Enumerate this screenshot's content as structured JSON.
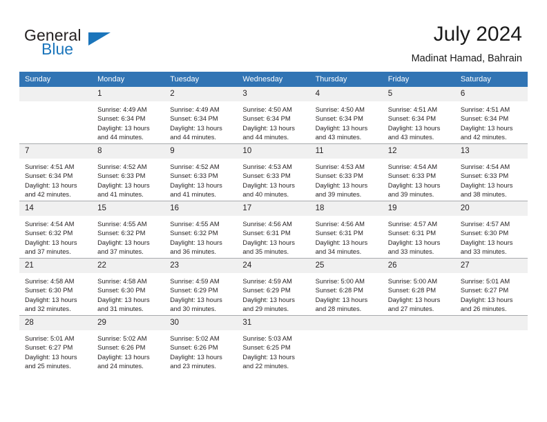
{
  "brand": {
    "line1": "General",
    "line2": "Blue",
    "accent_color": "#1b75bb"
  },
  "header": {
    "month_title": "July 2024",
    "location": "Madinat Hamad, Bahrain",
    "header_bg": "#3174b4",
    "daynum_bg": "#f0f0f0"
  },
  "weekday_headers": [
    "Sunday",
    "Monday",
    "Tuesday",
    "Wednesday",
    "Thursday",
    "Friday",
    "Saturday"
  ],
  "weeks": [
    [
      {
        "day": "",
        "sunrise": "",
        "sunset": "",
        "daylight1": "",
        "daylight2": ""
      },
      {
        "day": "1",
        "sunrise": "Sunrise: 4:49 AM",
        "sunset": "Sunset: 6:34 PM",
        "daylight1": "Daylight: 13 hours",
        "daylight2": "and 44 minutes."
      },
      {
        "day": "2",
        "sunrise": "Sunrise: 4:49 AM",
        "sunset": "Sunset: 6:34 PM",
        "daylight1": "Daylight: 13 hours",
        "daylight2": "and 44 minutes."
      },
      {
        "day": "3",
        "sunrise": "Sunrise: 4:50 AM",
        "sunset": "Sunset: 6:34 PM",
        "daylight1": "Daylight: 13 hours",
        "daylight2": "and 44 minutes."
      },
      {
        "day": "4",
        "sunrise": "Sunrise: 4:50 AM",
        "sunset": "Sunset: 6:34 PM",
        "daylight1": "Daylight: 13 hours",
        "daylight2": "and 43 minutes."
      },
      {
        "day": "5",
        "sunrise": "Sunrise: 4:51 AM",
        "sunset": "Sunset: 6:34 PM",
        "daylight1": "Daylight: 13 hours",
        "daylight2": "and 43 minutes."
      },
      {
        "day": "6",
        "sunrise": "Sunrise: 4:51 AM",
        "sunset": "Sunset: 6:34 PM",
        "daylight1": "Daylight: 13 hours",
        "daylight2": "and 42 minutes."
      }
    ],
    [
      {
        "day": "7",
        "sunrise": "Sunrise: 4:51 AM",
        "sunset": "Sunset: 6:34 PM",
        "daylight1": "Daylight: 13 hours",
        "daylight2": "and 42 minutes."
      },
      {
        "day": "8",
        "sunrise": "Sunrise: 4:52 AM",
        "sunset": "Sunset: 6:33 PM",
        "daylight1": "Daylight: 13 hours",
        "daylight2": "and 41 minutes."
      },
      {
        "day": "9",
        "sunrise": "Sunrise: 4:52 AM",
        "sunset": "Sunset: 6:33 PM",
        "daylight1": "Daylight: 13 hours",
        "daylight2": "and 41 minutes."
      },
      {
        "day": "10",
        "sunrise": "Sunrise: 4:53 AM",
        "sunset": "Sunset: 6:33 PM",
        "daylight1": "Daylight: 13 hours",
        "daylight2": "and 40 minutes."
      },
      {
        "day": "11",
        "sunrise": "Sunrise: 4:53 AM",
        "sunset": "Sunset: 6:33 PM",
        "daylight1": "Daylight: 13 hours",
        "daylight2": "and 39 minutes."
      },
      {
        "day": "12",
        "sunrise": "Sunrise: 4:54 AM",
        "sunset": "Sunset: 6:33 PM",
        "daylight1": "Daylight: 13 hours",
        "daylight2": "and 39 minutes."
      },
      {
        "day": "13",
        "sunrise": "Sunrise: 4:54 AM",
        "sunset": "Sunset: 6:33 PM",
        "daylight1": "Daylight: 13 hours",
        "daylight2": "and 38 minutes."
      }
    ],
    [
      {
        "day": "14",
        "sunrise": "Sunrise: 4:54 AM",
        "sunset": "Sunset: 6:32 PM",
        "daylight1": "Daylight: 13 hours",
        "daylight2": "and 37 minutes."
      },
      {
        "day": "15",
        "sunrise": "Sunrise: 4:55 AM",
        "sunset": "Sunset: 6:32 PM",
        "daylight1": "Daylight: 13 hours",
        "daylight2": "and 37 minutes."
      },
      {
        "day": "16",
        "sunrise": "Sunrise: 4:55 AM",
        "sunset": "Sunset: 6:32 PM",
        "daylight1": "Daylight: 13 hours",
        "daylight2": "and 36 minutes."
      },
      {
        "day": "17",
        "sunrise": "Sunrise: 4:56 AM",
        "sunset": "Sunset: 6:31 PM",
        "daylight1": "Daylight: 13 hours",
        "daylight2": "and 35 minutes."
      },
      {
        "day": "18",
        "sunrise": "Sunrise: 4:56 AM",
        "sunset": "Sunset: 6:31 PM",
        "daylight1": "Daylight: 13 hours",
        "daylight2": "and 34 minutes."
      },
      {
        "day": "19",
        "sunrise": "Sunrise: 4:57 AM",
        "sunset": "Sunset: 6:31 PM",
        "daylight1": "Daylight: 13 hours",
        "daylight2": "and 33 minutes."
      },
      {
        "day": "20",
        "sunrise": "Sunrise: 4:57 AM",
        "sunset": "Sunset: 6:30 PM",
        "daylight1": "Daylight: 13 hours",
        "daylight2": "and 33 minutes."
      }
    ],
    [
      {
        "day": "21",
        "sunrise": "Sunrise: 4:58 AM",
        "sunset": "Sunset: 6:30 PM",
        "daylight1": "Daylight: 13 hours",
        "daylight2": "and 32 minutes."
      },
      {
        "day": "22",
        "sunrise": "Sunrise: 4:58 AM",
        "sunset": "Sunset: 6:30 PM",
        "daylight1": "Daylight: 13 hours",
        "daylight2": "and 31 minutes."
      },
      {
        "day": "23",
        "sunrise": "Sunrise: 4:59 AM",
        "sunset": "Sunset: 6:29 PM",
        "daylight1": "Daylight: 13 hours",
        "daylight2": "and 30 minutes."
      },
      {
        "day": "24",
        "sunrise": "Sunrise: 4:59 AM",
        "sunset": "Sunset: 6:29 PM",
        "daylight1": "Daylight: 13 hours",
        "daylight2": "and 29 minutes."
      },
      {
        "day": "25",
        "sunrise": "Sunrise: 5:00 AM",
        "sunset": "Sunset: 6:28 PM",
        "daylight1": "Daylight: 13 hours",
        "daylight2": "and 28 minutes."
      },
      {
        "day": "26",
        "sunrise": "Sunrise: 5:00 AM",
        "sunset": "Sunset: 6:28 PM",
        "daylight1": "Daylight: 13 hours",
        "daylight2": "and 27 minutes."
      },
      {
        "day": "27",
        "sunrise": "Sunrise: 5:01 AM",
        "sunset": "Sunset: 6:27 PM",
        "daylight1": "Daylight: 13 hours",
        "daylight2": "and 26 minutes."
      }
    ],
    [
      {
        "day": "28",
        "sunrise": "Sunrise: 5:01 AM",
        "sunset": "Sunset: 6:27 PM",
        "daylight1": "Daylight: 13 hours",
        "daylight2": "and 25 minutes."
      },
      {
        "day": "29",
        "sunrise": "Sunrise: 5:02 AM",
        "sunset": "Sunset: 6:26 PM",
        "daylight1": "Daylight: 13 hours",
        "daylight2": "and 24 minutes."
      },
      {
        "day": "30",
        "sunrise": "Sunrise: 5:02 AM",
        "sunset": "Sunset: 6:26 PM",
        "daylight1": "Daylight: 13 hours",
        "daylight2": "and 23 minutes."
      },
      {
        "day": "31",
        "sunrise": "Sunrise: 5:03 AM",
        "sunset": "Sunset: 6:25 PM",
        "daylight1": "Daylight: 13 hours",
        "daylight2": "and 22 minutes."
      },
      {
        "day": "",
        "sunrise": "",
        "sunset": "",
        "daylight1": "",
        "daylight2": ""
      },
      {
        "day": "",
        "sunrise": "",
        "sunset": "",
        "daylight1": "",
        "daylight2": ""
      },
      {
        "day": "",
        "sunrise": "",
        "sunset": "",
        "daylight1": "",
        "daylight2": ""
      }
    ]
  ]
}
